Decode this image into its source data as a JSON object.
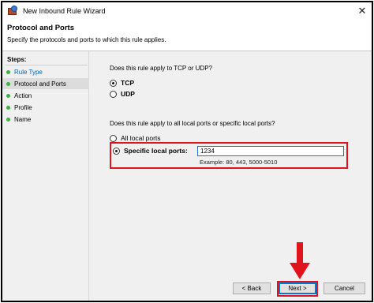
{
  "window": {
    "title": "New Inbound Rule Wizard",
    "close_glyph": "✕"
  },
  "header": {
    "title": "Protocol and Ports",
    "description": "Specify the protocols and ports to which this rule applies."
  },
  "steps": {
    "label": "Steps:",
    "items": [
      {
        "label": "Rule Type"
      },
      {
        "label": "Protocol and Ports"
      },
      {
        "label": "Action"
      },
      {
        "label": "Profile"
      },
      {
        "label": "Name"
      }
    ]
  },
  "protocol": {
    "question": "Does this rule apply to TCP or UDP?",
    "options": [
      {
        "label": "TCP",
        "selected": true
      },
      {
        "label": "UDP",
        "selected": false
      }
    ]
  },
  "ports": {
    "question": "Does this rule apply to all local ports or specific local ports?",
    "options": [
      {
        "label": "All local ports",
        "selected": false
      },
      {
        "label": "Specific local ports:",
        "selected": true
      }
    ],
    "value": "1234",
    "example": "Example: 80, 443, 5000-5010"
  },
  "buttons": {
    "back": "< Back",
    "next": "Next >",
    "cancel": "Cancel"
  },
  "colors": {
    "annotation_red": "#e0141c",
    "step_done": "#3cb043",
    "link_blue": "#0063b1"
  }
}
